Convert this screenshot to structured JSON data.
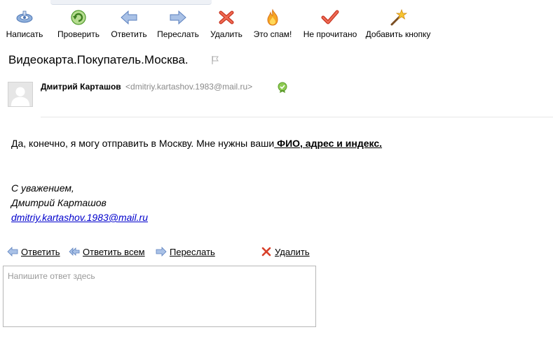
{
  "toolbar": {
    "compose": "Написать",
    "check": "Проверить",
    "reply": "Ответить",
    "forward": "Переслать",
    "delete": "Удалить",
    "spam": "Это спам!",
    "unread": "Не прочитано",
    "add_button": "Добавить кнопку"
  },
  "message": {
    "subject": "Видеокарта.Покупатель.Москва.",
    "sender_name": "Дмитрий Карташов",
    "sender_email": "<dmitriy.kartashov.1983@mail.ru>",
    "body_text": "Да, конечно, я могу отправить в Москву. Мне нужны ваши",
    "body_bold": " ФИО, адрес и индекс.",
    "sig_regards": "С уважением,",
    "sig_name": "Дмитрий Карташов",
    "sig_email": "dmitriy.kartashov.1983@mail.ru"
  },
  "actions": {
    "reply": "Ответить",
    "reply_all": "Ответить всем",
    "forward": "Переслать",
    "delete": "Удалить"
  },
  "reply_box": {
    "placeholder": "Напишите ответ здесь"
  },
  "colors": {
    "link": "#0000cc",
    "email_gray": "#8a8a8a",
    "accent_blue": "#6f93c9",
    "delete_red": "#e2503a",
    "check_green": "#58a33c"
  }
}
